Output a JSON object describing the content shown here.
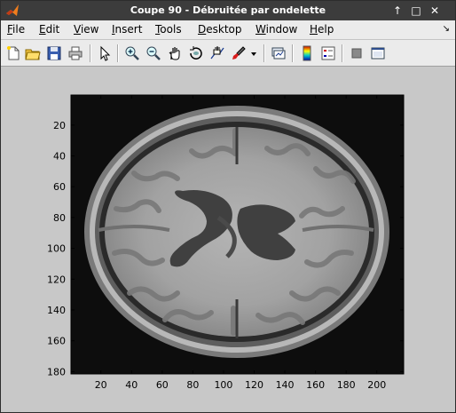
{
  "window": {
    "title": "Coupe 90 - Débruitée par ondelette",
    "buttons": {
      "maximize": "↑",
      "minimize": "□",
      "close": "✕"
    }
  },
  "menubar": {
    "items": [
      {
        "label": "File",
        "mnemonic": "F"
      },
      {
        "label": "Edit",
        "mnemonic": "E"
      },
      {
        "label": "View",
        "mnemonic": "V"
      },
      {
        "label": "Insert",
        "mnemonic": "I"
      },
      {
        "label": "Tools",
        "mnemonic": "T"
      },
      {
        "label": "Desktop",
        "mnemonic": "D"
      },
      {
        "label": "Window",
        "mnemonic": "W"
      },
      {
        "label": "Help",
        "mnemonic": "H"
      }
    ]
  },
  "toolbar": {
    "icons": [
      "new-figure-icon",
      "open-file-icon",
      "save-figure-icon",
      "print-figure-icon",
      "edit-plot-icon",
      "zoom-in-icon",
      "zoom-out-icon",
      "pan-hand-icon",
      "rotate-3d-icon",
      "data-cursor-icon",
      "brush-icon",
      "brush-dropdown-icon",
      "link-plot-icon",
      "insert-colorbar-icon",
      "insert-legend-icon",
      "hide-plot-tools-icon",
      "show-plot-tools-icon"
    ]
  },
  "axes": {
    "xticks": [
      "20",
      "40",
      "60",
      "80",
      "100",
      "120",
      "140",
      "160",
      "180",
      "200"
    ],
    "yticks": [
      "20",
      "40",
      "60",
      "80",
      "100",
      "120",
      "140",
      "160",
      "180"
    ],
    "xlim": [
      0.5,
      217.5
    ],
    "ylim": [
      0.5,
      181.5
    ]
  },
  "image": {
    "description_type": "grayscale axial brain MRI slice",
    "colormap": "gray"
  },
  "colors": {
    "titlebar": "#3c3c3c",
    "menubar": "#ebebeb",
    "figure_bg": "#c8c8c8"
  }
}
